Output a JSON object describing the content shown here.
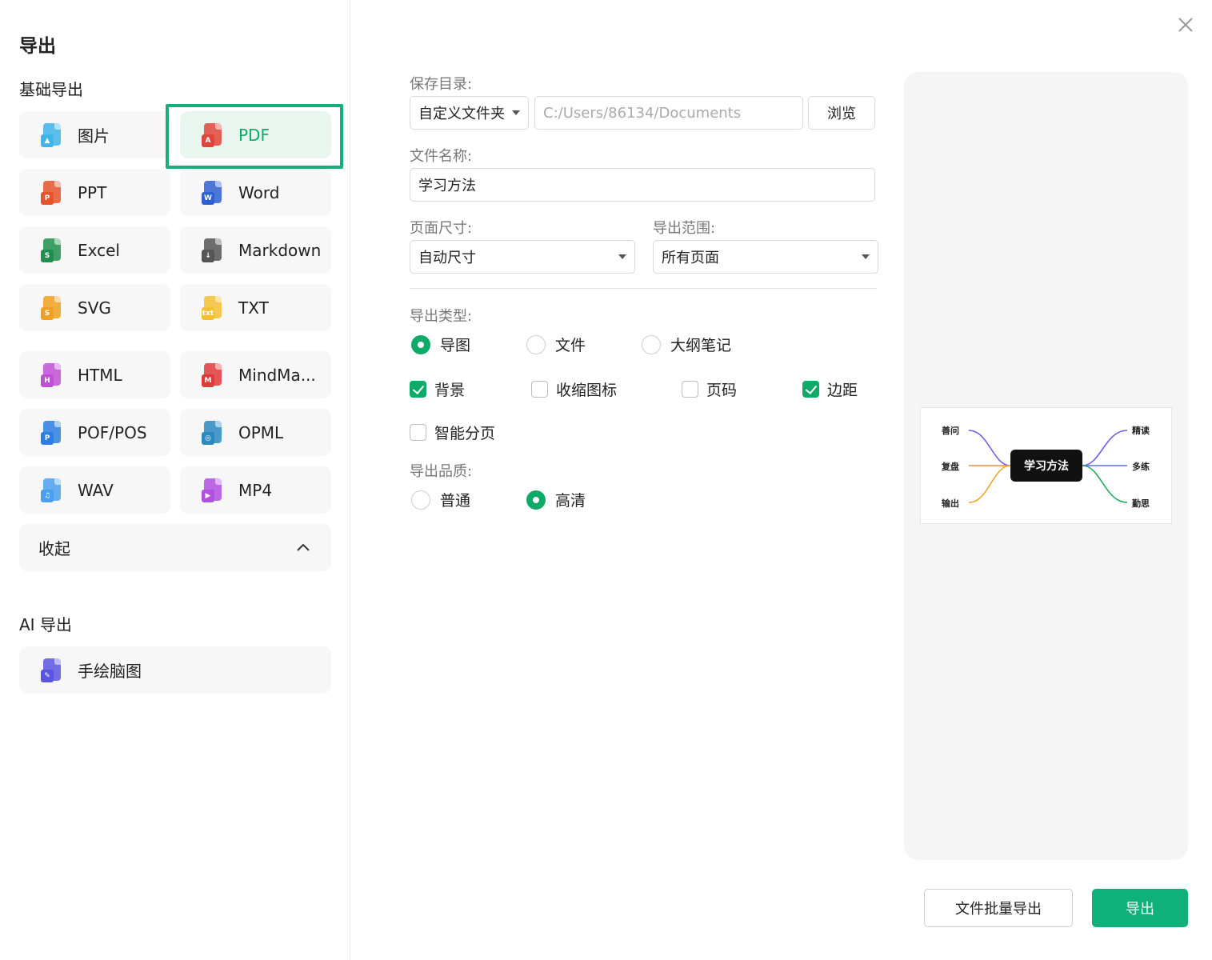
{
  "dialog": {
    "title": "导出"
  },
  "basic_section": {
    "title": "基础导出"
  },
  "ai_section": {
    "title": "AI 导出"
  },
  "formats": [
    {
      "label": "图片",
      "icon": "image-file-icon",
      "color": "#3fb4e8",
      "glyph": "▲"
    },
    {
      "label": "PDF",
      "icon": "pdf-file-icon",
      "color": "#e0453b",
      "glyph": "A"
    },
    {
      "label": "PPT",
      "icon": "ppt-file-icon",
      "color": "#e5542b",
      "glyph": "P"
    },
    {
      "label": "Word",
      "icon": "word-file-icon",
      "color": "#2f5fd0",
      "glyph": "W"
    },
    {
      "label": "Excel",
      "icon": "excel-file-icon",
      "color": "#1e8f4e",
      "glyph": "S"
    },
    {
      "label": "Markdown",
      "icon": "markdown-file-icon",
      "color": "#555555",
      "glyph": "↓"
    },
    {
      "label": "SVG",
      "icon": "svg-file-icon",
      "color": "#f0a020",
      "glyph": "S"
    },
    {
      "label": "TXT",
      "icon": "txt-file-icon",
      "color": "#f5c030",
      "glyph": "txt"
    },
    {
      "label": "HTML",
      "icon": "html-file-icon",
      "color": "#c04fd6",
      "glyph": "H"
    },
    {
      "label": "MindMa...",
      "icon": "mindmanager-file-icon",
      "color": "#e03a3a",
      "glyph": "M"
    },
    {
      "label": "POF/POS",
      "icon": "pof-file-icon",
      "color": "#2b7fe0",
      "glyph": "P"
    },
    {
      "label": "OPML",
      "icon": "opml-file-icon",
      "color": "#2a8ac0",
      "glyph": "◎"
    },
    {
      "label": "WAV",
      "icon": "wav-file-icon",
      "color": "#4aa0f0",
      "glyph": "♫"
    },
    {
      "label": "MP4",
      "icon": "mp4-file-icon",
      "color": "#b04fe0",
      "glyph": "▶"
    }
  ],
  "selected_format": "PDF",
  "collapse": {
    "label": "收起"
  },
  "ai_formats": [
    {
      "label": "手绘脑图",
      "icon": "handdrawn-file-icon",
      "color": "#5a55e0",
      "glyph": "✎"
    }
  ],
  "form": {
    "save_dir_label": "保存目录:",
    "save_dir_select": "自定义文件夹",
    "save_dir_path": "C:/Users/86134/Documents",
    "browse_label": "浏览",
    "filename_label": "文件名称:",
    "filename_value": "学习方法",
    "page_size_label": "页面尺寸:",
    "page_size_value": "自动尺寸",
    "range_label": "导出范围:",
    "range_value": "所有页面",
    "type_label": "导出类型:",
    "types": [
      {
        "label": "导图",
        "checked": true
      },
      {
        "label": "文件",
        "checked": false
      },
      {
        "label": "大纲笔记",
        "checked": false
      }
    ],
    "options": [
      {
        "label": "背景",
        "checked": true
      },
      {
        "label": "收缩图标",
        "checked": false
      },
      {
        "label": "页码",
        "checked": false
      },
      {
        "label": "边距",
        "checked": true
      },
      {
        "label": "智能分页",
        "checked": false
      }
    ],
    "quality_label": "导出品质:",
    "qualities": [
      {
        "label": "普通",
        "checked": false
      },
      {
        "label": "高清",
        "checked": true
      }
    ]
  },
  "preview": {
    "center": "学习方法",
    "left_nodes": [
      "善问",
      "复盘",
      "输出"
    ],
    "right_nodes": [
      "精读",
      "多练",
      "勤思"
    ],
    "colors": {
      "purple": "#7a5ce6",
      "orange": "#f08a3c",
      "amber": "#f3a52d",
      "blue": "#5a72e8",
      "green": "#1faa62"
    }
  },
  "actions": {
    "batch_label": "文件批量导出",
    "export_label": "导出"
  },
  "theme": {
    "accent": "#10b07a"
  }
}
